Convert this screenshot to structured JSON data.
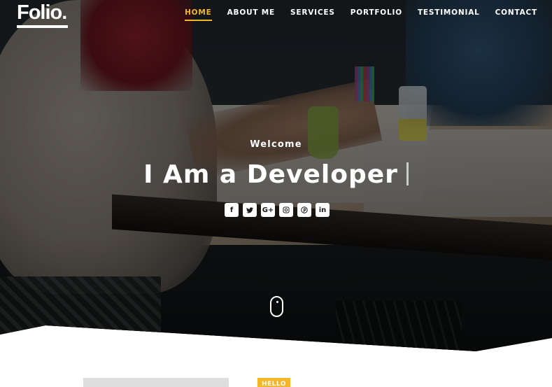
{
  "brand": {
    "logo_text": "Folio."
  },
  "nav": {
    "items": [
      {
        "label": "HOME",
        "active": true
      },
      {
        "label": "ABOUT ME",
        "active": false
      },
      {
        "label": "SERVICES",
        "active": false
      },
      {
        "label": "PORTFOLIO",
        "active": false
      },
      {
        "label": "TESTIMONIAL",
        "active": false
      },
      {
        "label": "CONTACT",
        "active": false
      }
    ]
  },
  "hero": {
    "welcome": "Welcome",
    "headline": "I Am a Developer",
    "social": [
      {
        "icon": "facebook-icon",
        "glyph": "f"
      },
      {
        "icon": "twitter-icon",
        "glyph": "🐦"
      },
      {
        "icon": "google-plus-icon",
        "glyph": "G+"
      },
      {
        "icon": "instagram-icon",
        "glyph": "◎"
      },
      {
        "icon": "pinterest-icon",
        "glyph": "℗"
      },
      {
        "icon": "linkedin-icon",
        "glyph": "in"
      }
    ],
    "scroll_icon": "mouse-scroll-icon"
  },
  "about": {
    "badge": "HELLO"
  },
  "colors": {
    "accent": "#f5b629",
    "text_light": "#ffffff",
    "placeholder": "#dedede"
  }
}
